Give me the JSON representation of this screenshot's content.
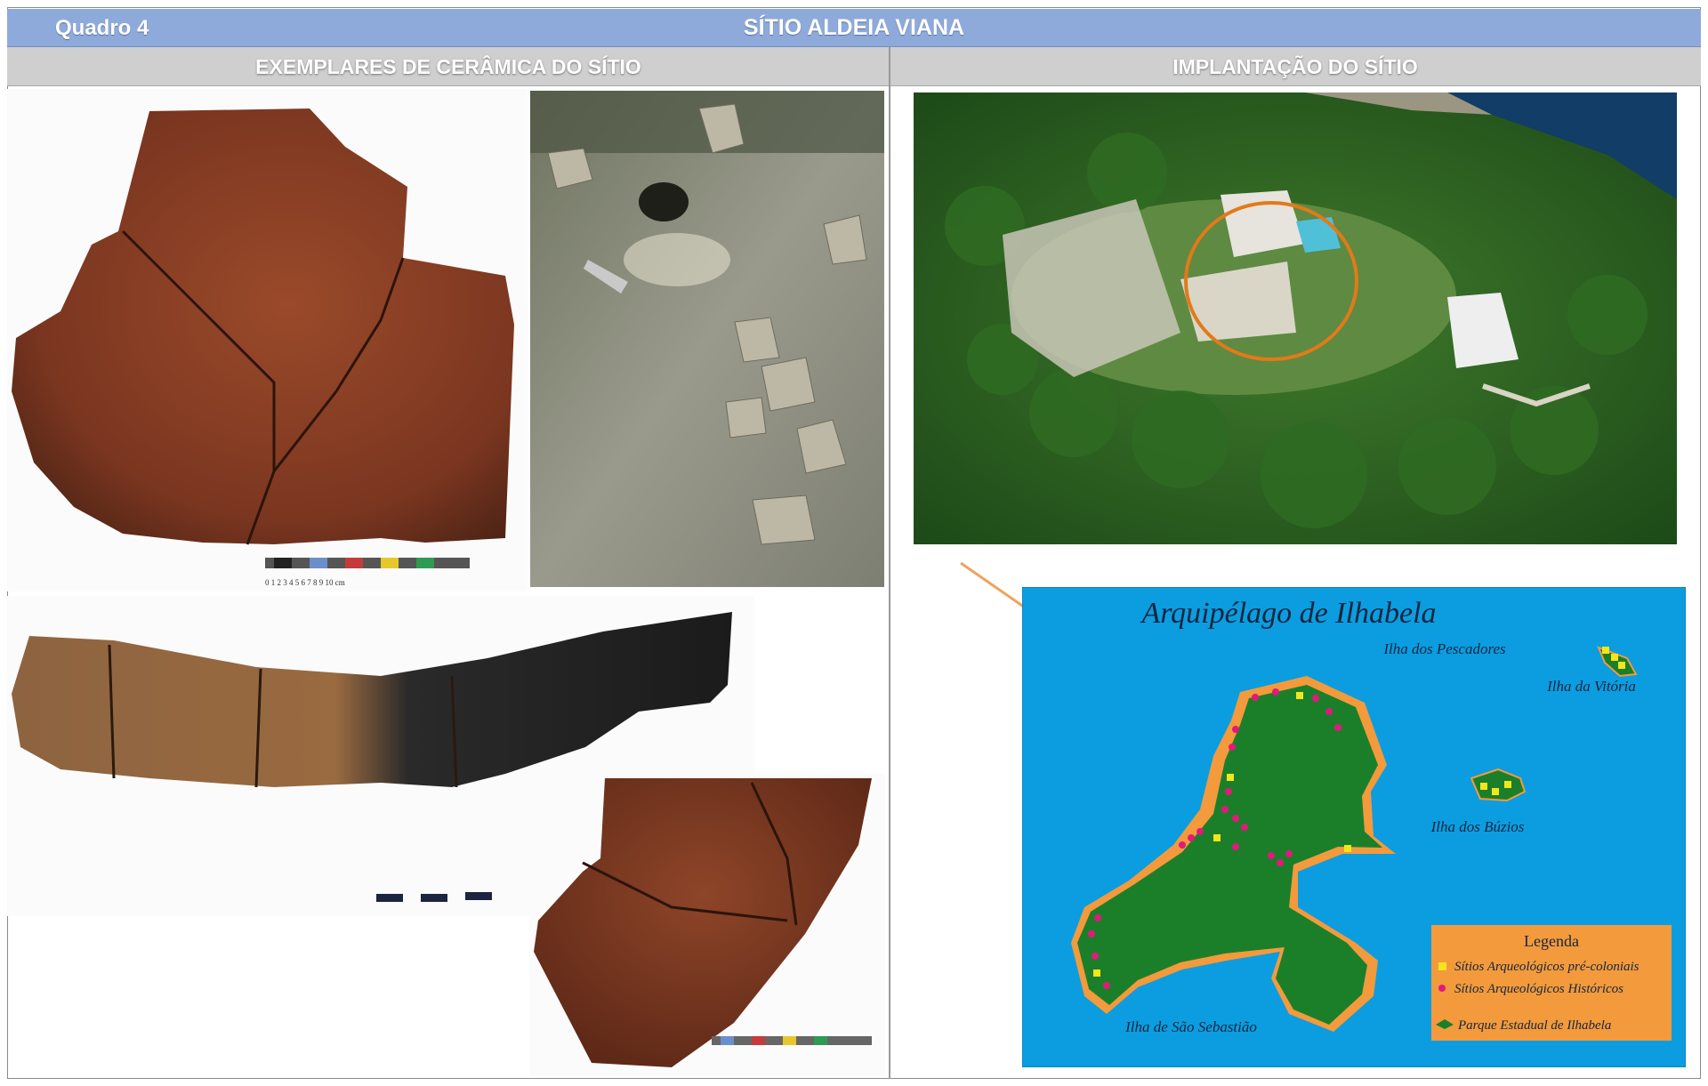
{
  "header": {
    "quadro_label": "Quadro 4",
    "site_title": "SÍTIO ALDEIA VIANA"
  },
  "columns": {
    "left_heading": "EXEMPLARES DE CERÂMICA DO SÍTIO",
    "right_heading": "IMPLANTAÇÃO DO SÍTIO"
  },
  "map": {
    "title": "Arquipélago de Ilhabela",
    "labels": {
      "pescadores": "Ilha dos Pescadores",
      "vitoria": "Ilha da Vitória",
      "buzios": "Ilha dos Búzios",
      "sao_sebastiao": "Ilha de São Sebastião"
    },
    "legend": {
      "title": "Legenda",
      "items": [
        "Sítios Arqueológicos pré-coloniais",
        "Sítios Arqueológicos Históricos",
        "Parque Estadual de Ilhabela"
      ]
    },
    "colors": {
      "sea": "#0b9de0",
      "island": "#1b7f2a",
      "coast": "#f39a3c",
      "precolonial": "#f5e51b",
      "historic": "#e2197c"
    }
  },
  "scale": {
    "label": "0 1 2 3 4 5 6 7 8 9 10 cm"
  }
}
